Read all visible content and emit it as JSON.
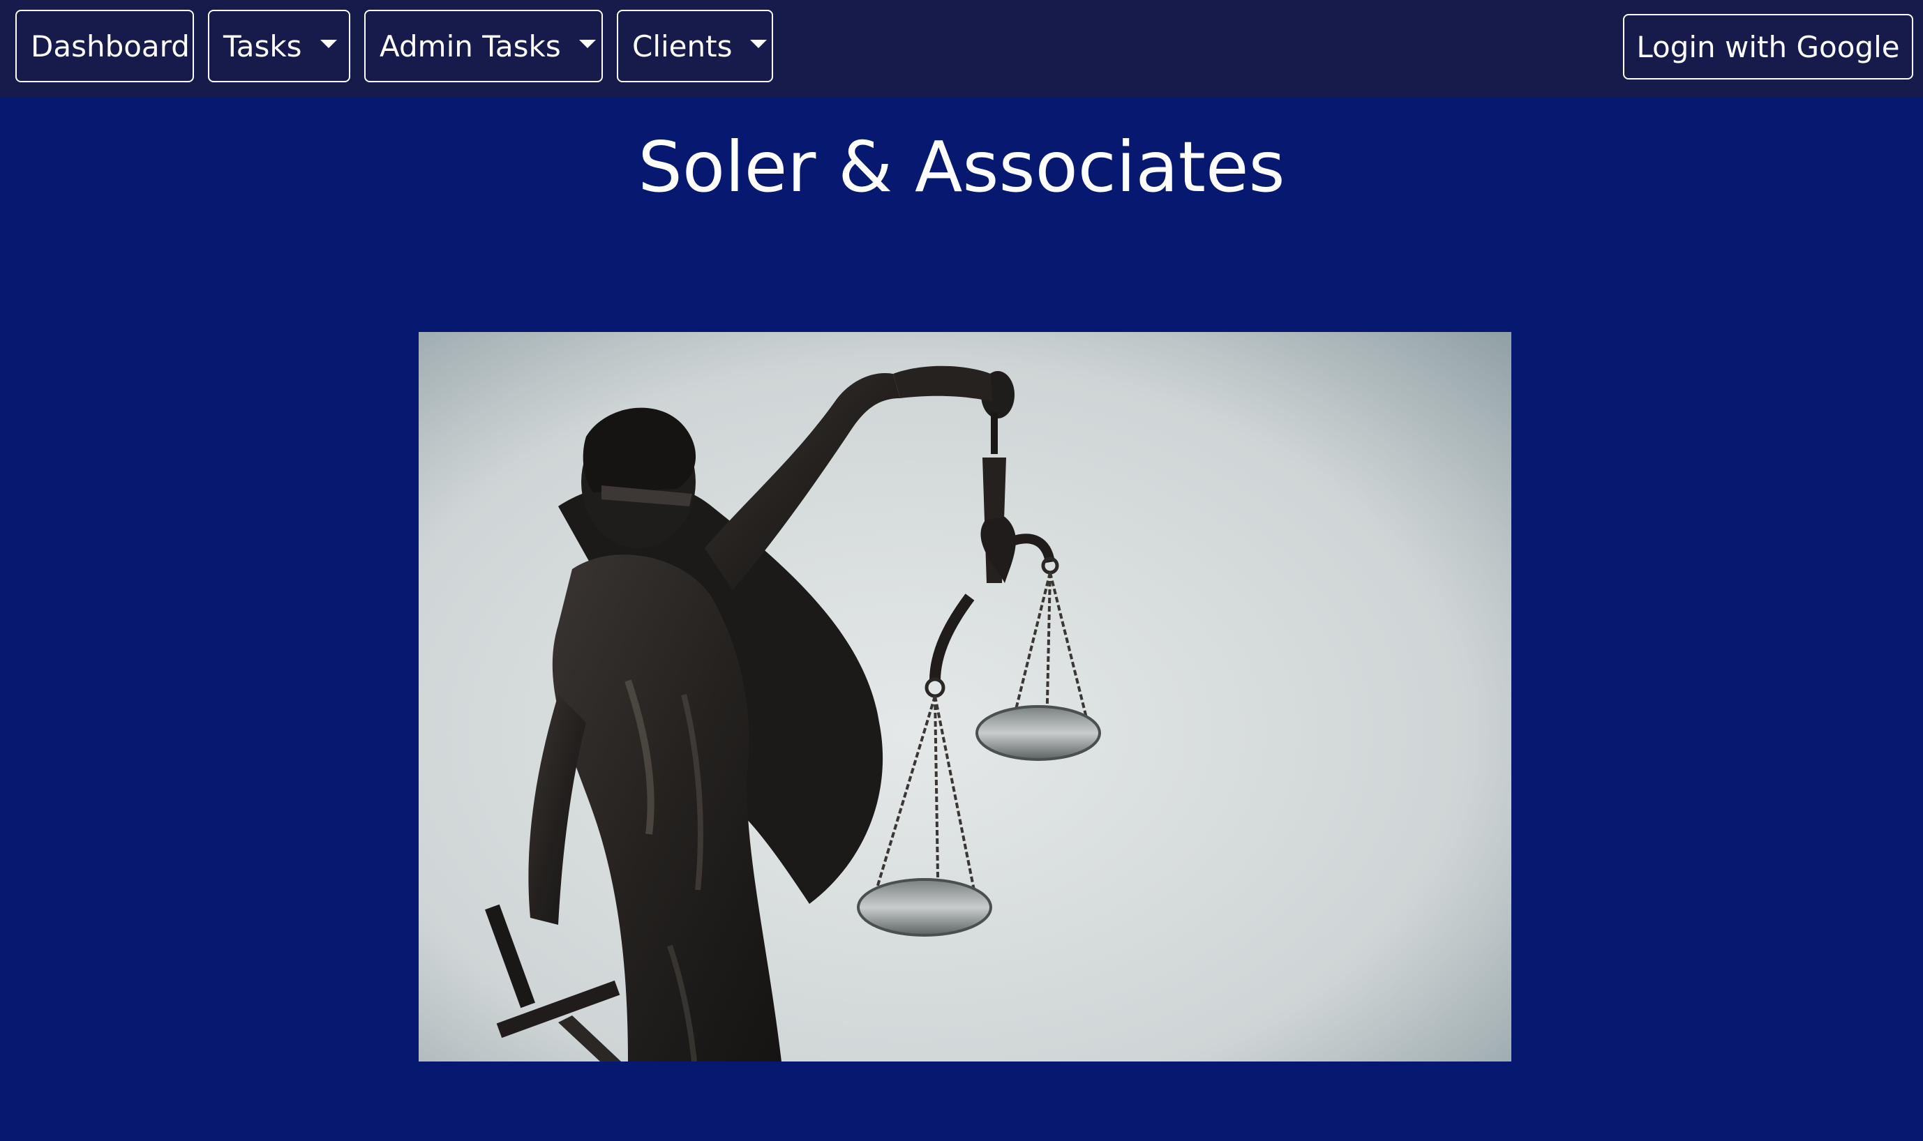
{
  "nav": {
    "items": [
      {
        "label": "Dashboard",
        "has_dropdown": false
      },
      {
        "label": "Tasks",
        "has_dropdown": true
      },
      {
        "label": "Admin Tasks",
        "has_dropdown": true
      },
      {
        "label": "Clients",
        "has_dropdown": true
      }
    ],
    "login_label": "Login with Google"
  },
  "page": {
    "title": "Soler & Associates"
  },
  "hero_image": {
    "icon": "lady-justice-statue-image"
  },
  "colors": {
    "navbar_bg": "#171b4b",
    "page_bg": "#061870",
    "text": "#ffffff"
  }
}
